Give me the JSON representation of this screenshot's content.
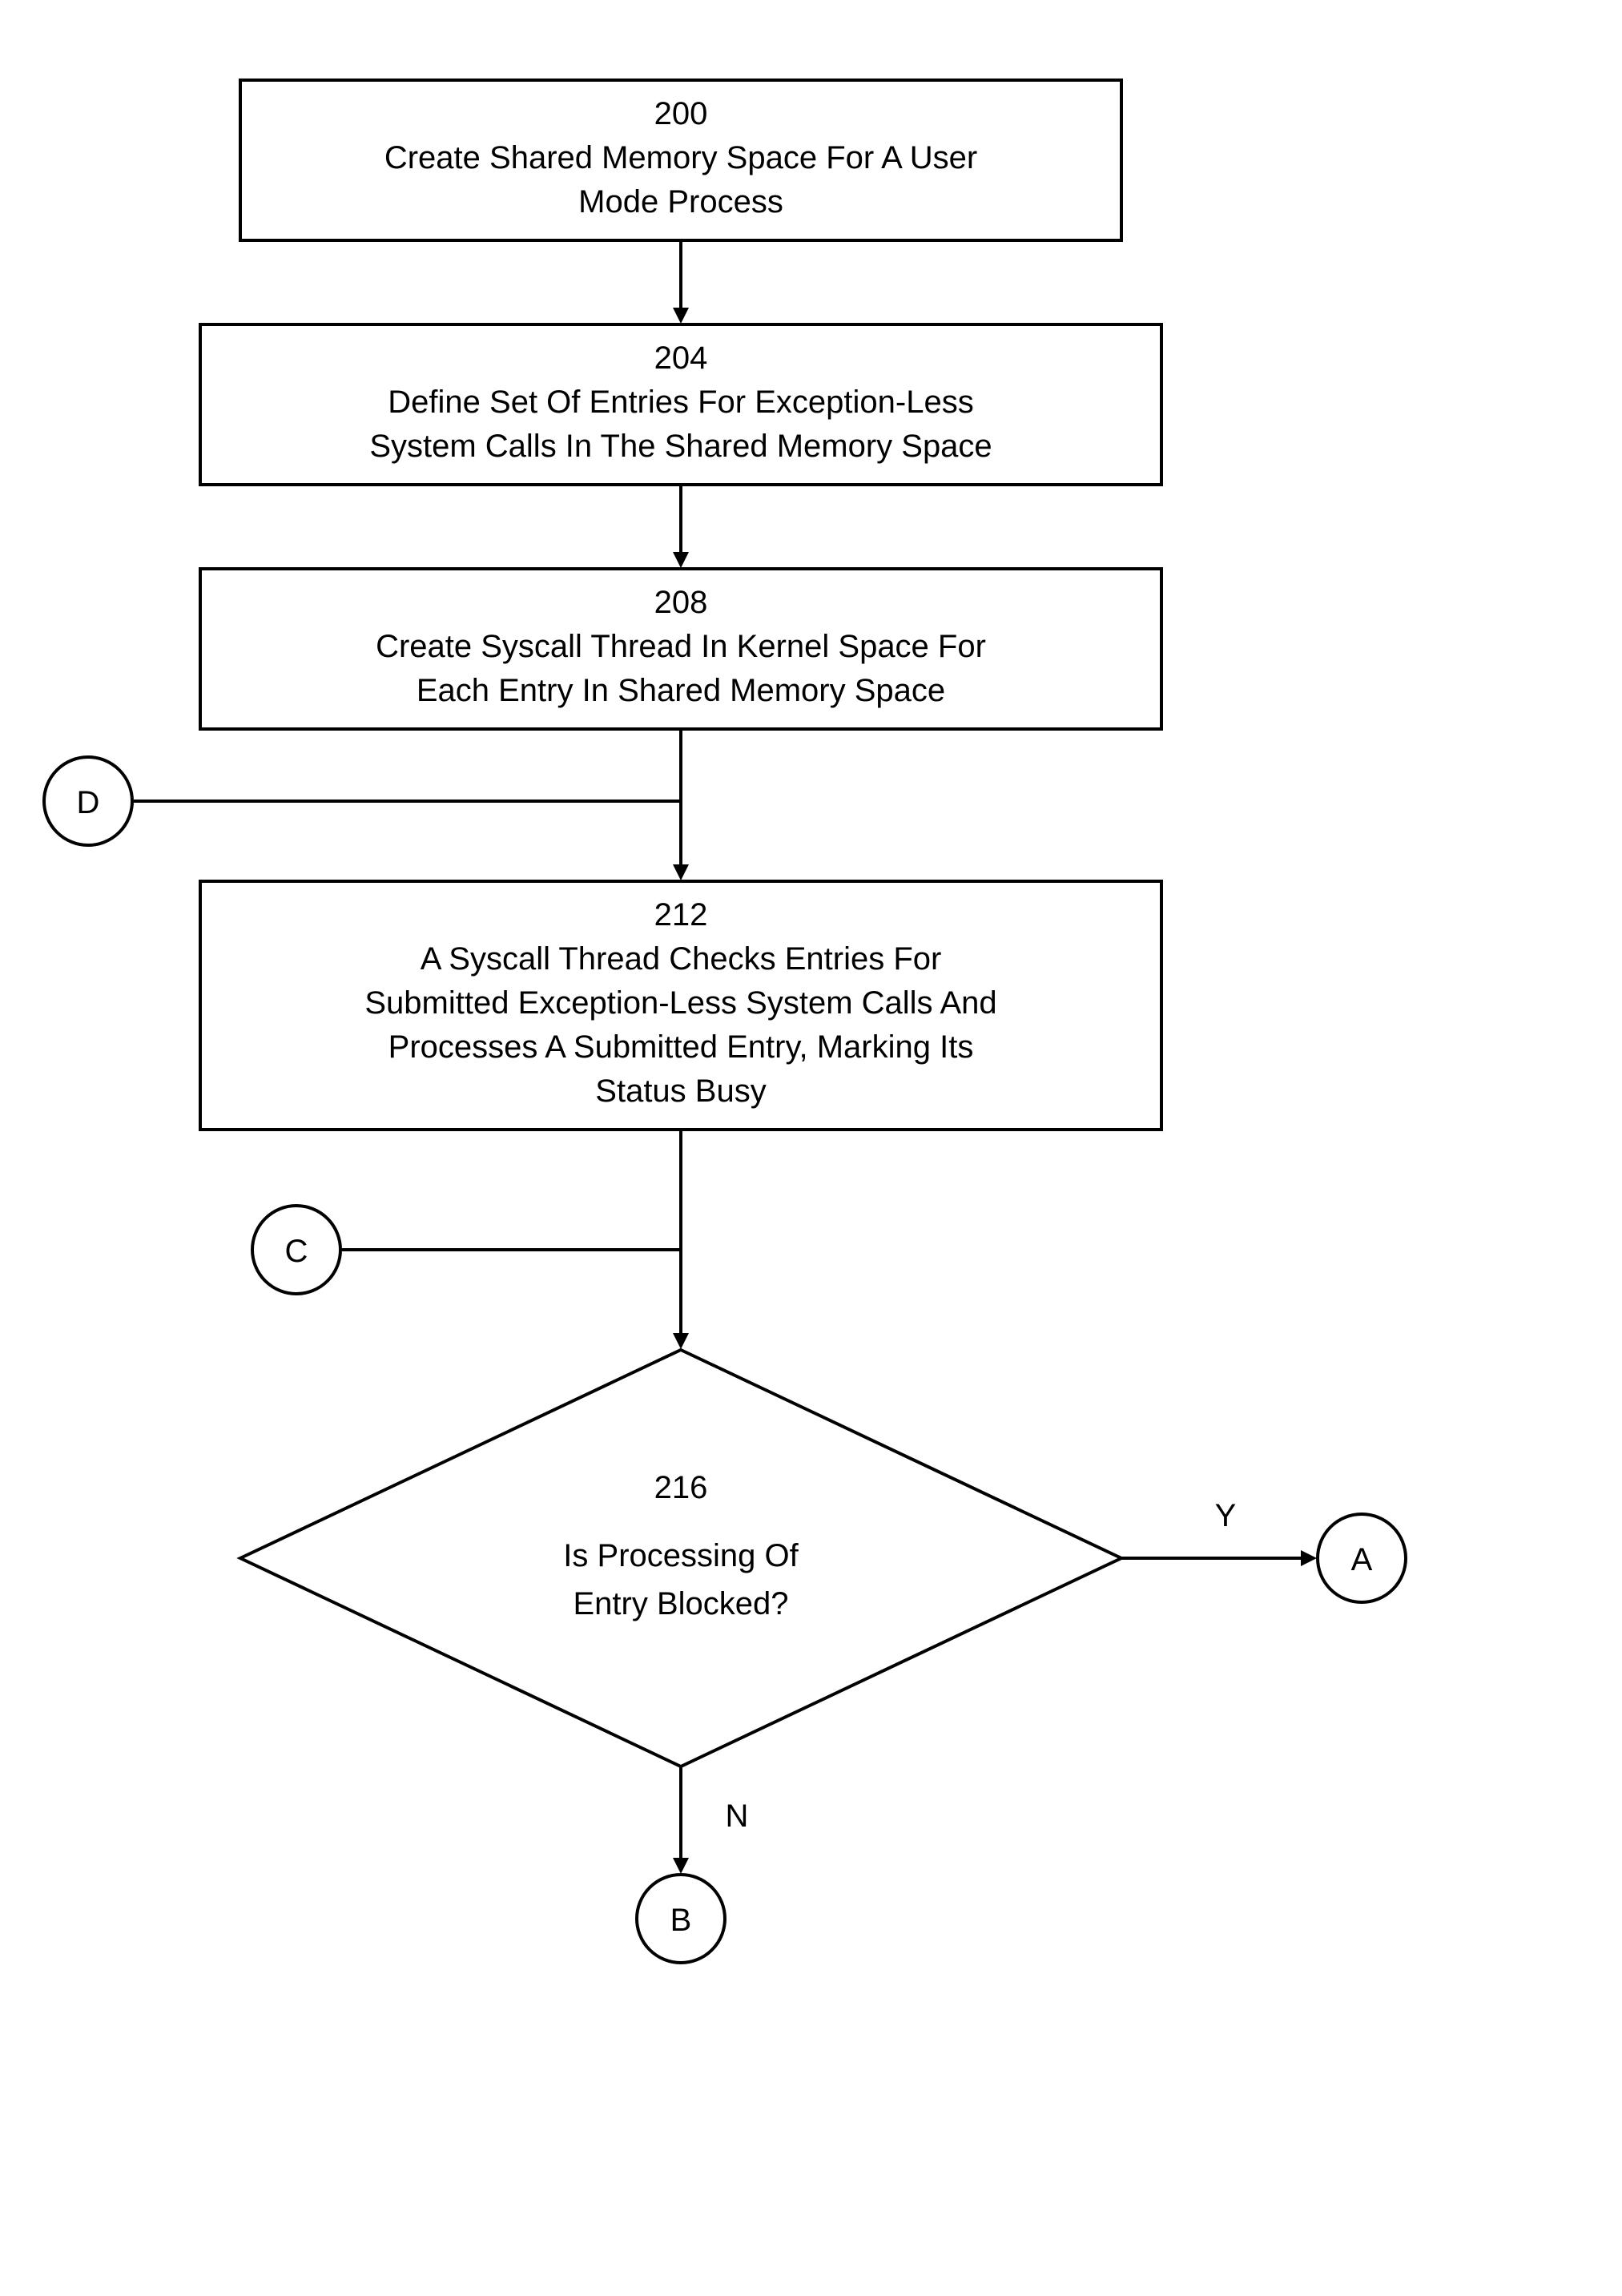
{
  "boxes": {
    "b200": {
      "num": "200",
      "l1": "Create Shared Memory Space For A User",
      "l2": "Mode Process"
    },
    "b204": {
      "num": "204",
      "l1": "Define Set Of Entries For Exception-Less",
      "l2": "System Calls In The Shared Memory Space"
    },
    "b208": {
      "num": "208",
      "l1": "Create Syscall Thread In Kernel Space For",
      "l2": "Each Entry In Shared Memory Space"
    },
    "b212": {
      "num": "212",
      "l1": "A Syscall Thread Checks Entries For",
      "l2": "Submitted Exception-Less System Calls And",
      "l3": "Processes A Submitted Entry, Marking Its",
      "l4": "Status Busy"
    },
    "d216": {
      "num": "216",
      "l1": "Is Processing Of",
      "l2": "Entry Blocked?"
    }
  },
  "connectors": {
    "A": "A",
    "B": "B",
    "C": "C",
    "D": "D"
  },
  "labels": {
    "Y": "Y",
    "N": "N"
  }
}
